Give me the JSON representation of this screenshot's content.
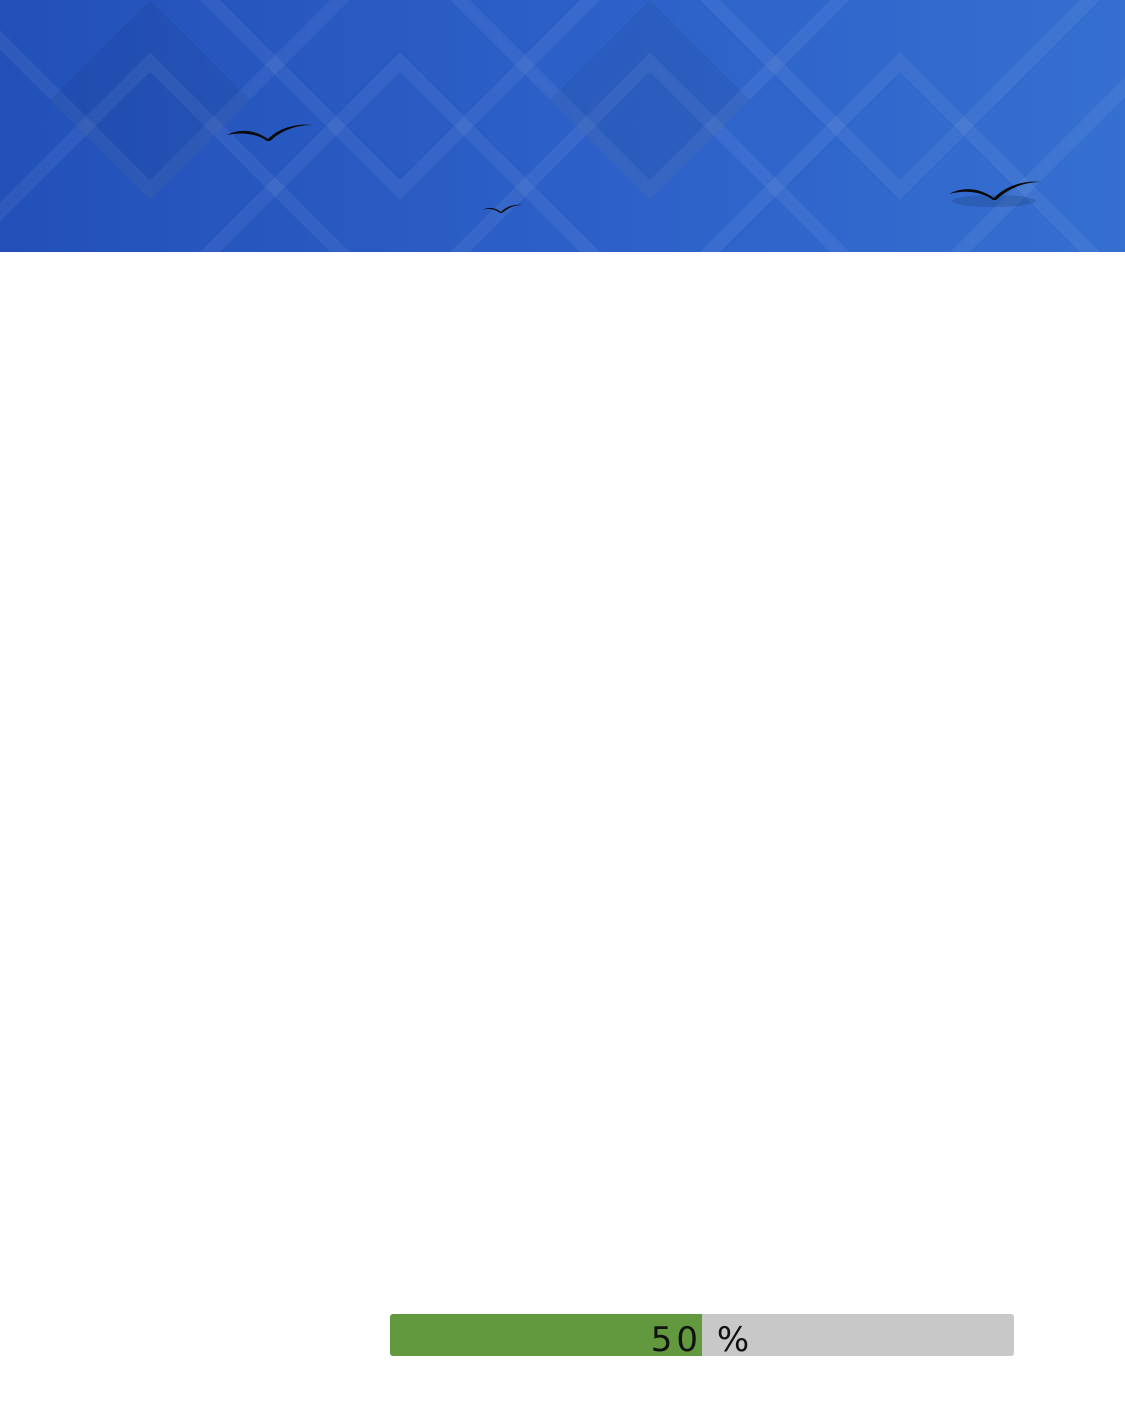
{
  "banner": {
    "background_color": "#2a5ac2",
    "icons": [
      "seagull-icon",
      "seagull-icon",
      "seagull-icon"
    ]
  },
  "progress": {
    "value_percent": 50,
    "label_text": "50 %",
    "fill_color": "#62993e",
    "track_color": "#c8c8c8"
  }
}
